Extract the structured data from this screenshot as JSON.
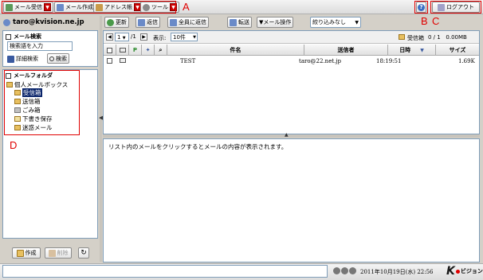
{
  "toolbar": {
    "receive_label": "メール受信",
    "compose_label": "メール作成",
    "address_label": "アドレス帳",
    "tools_label": "ツール",
    "logout_label": "ログアウト",
    "help_glyph": "?"
  },
  "annotations": {
    "a": "A",
    "b": "B",
    "c": "C",
    "d": "D"
  },
  "user": {
    "email": "taro@kvision.ne.jp"
  },
  "search": {
    "heading": "メール検索",
    "placeholder": "検索語を入力",
    "value": "検索語を入力",
    "detail_label": "詳細検索",
    "button_label": "検索"
  },
  "folders": {
    "heading": "メールフォルダ",
    "root": "個人メールボックス",
    "items": [
      "受信箱",
      "送信箱",
      "ごみ箱",
      "下書き保存",
      "迷惑メール"
    ],
    "create_label": "作成",
    "delete_label": "削除"
  },
  "actions": {
    "refresh_label": "更新",
    "reply_label": "返信",
    "reply_all_label": "全員に返信",
    "forward_label": "転送",
    "mail_ops_label": "▼メール操作",
    "filter_value": "絞り込みなし"
  },
  "pager": {
    "page_value": "1",
    "page_total": "/1",
    "display_label": "表示:",
    "per_page": "10件",
    "folder_name": "受信箱",
    "folder_stats": "0 / 1   0.00MB"
  },
  "table": {
    "headers": {
      "subject": "件名",
      "sender": "送信者",
      "date": "日時",
      "size": "サイズ"
    },
    "rows": [
      {
        "subject": "TEST",
        "sender": "taro@22.net.jp",
        "date": "18:19:51",
        "size": "1.69K"
      }
    ]
  },
  "preview": {
    "message": "リスト内のメールをクリックするとメールの内容が表示されます。"
  },
  "status": {
    "datetime": "2011年10月19日(水) 22:56",
    "logo_k": "K",
    "logo_text": "ビジョン"
  },
  "colors": {
    "annotation": "#e00000",
    "selected_folder": "#0a246a"
  }
}
